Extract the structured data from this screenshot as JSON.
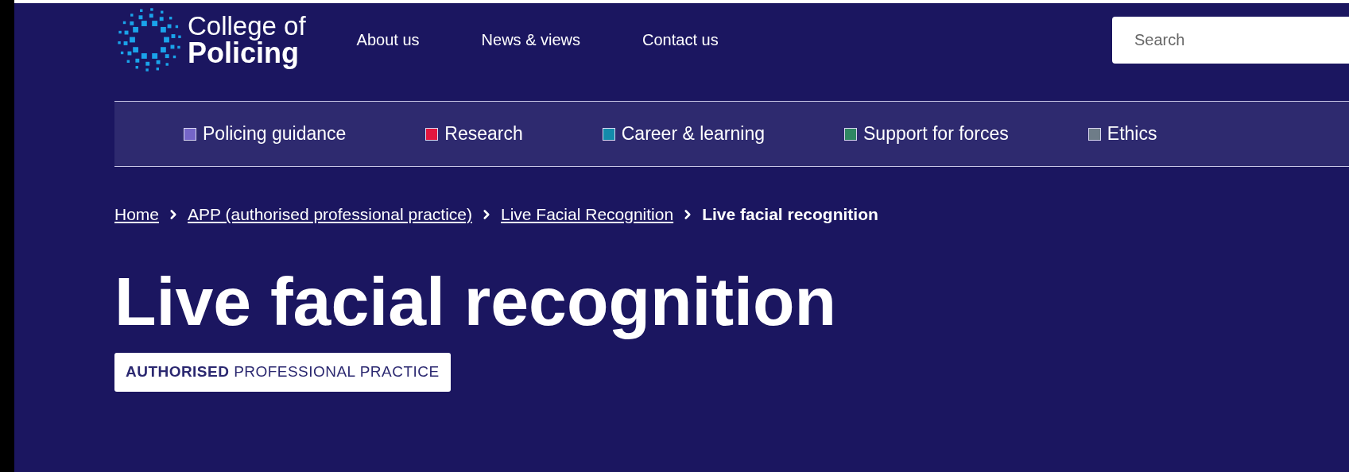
{
  "header": {
    "logo": {
      "line_1": "College of",
      "line_2": "Policing"
    },
    "links": [
      "About us",
      "News & views",
      "Contact us"
    ],
    "search": {
      "placeholder": "Search"
    }
  },
  "nav": {
    "items": [
      {
        "label": "Policing guidance",
        "color": "#7565c8"
      },
      {
        "label": "Research",
        "color": "#e2163f"
      },
      {
        "label": "Career & learning",
        "color": "#138bab"
      },
      {
        "label": "Support for forces",
        "color": "#2f8763"
      },
      {
        "label": "Ethics",
        "color": "#6e7c88"
      }
    ]
  },
  "breadcrumb": {
    "links": [
      "Home",
      "APP (authorised professional practice)",
      "Live Facial Recognition"
    ],
    "current": "Live facial recognition"
  },
  "page": {
    "title": "Live facial recognition",
    "badge": "**AUTHORISED** PROFESSIONAL PRACTICE"
  }
}
